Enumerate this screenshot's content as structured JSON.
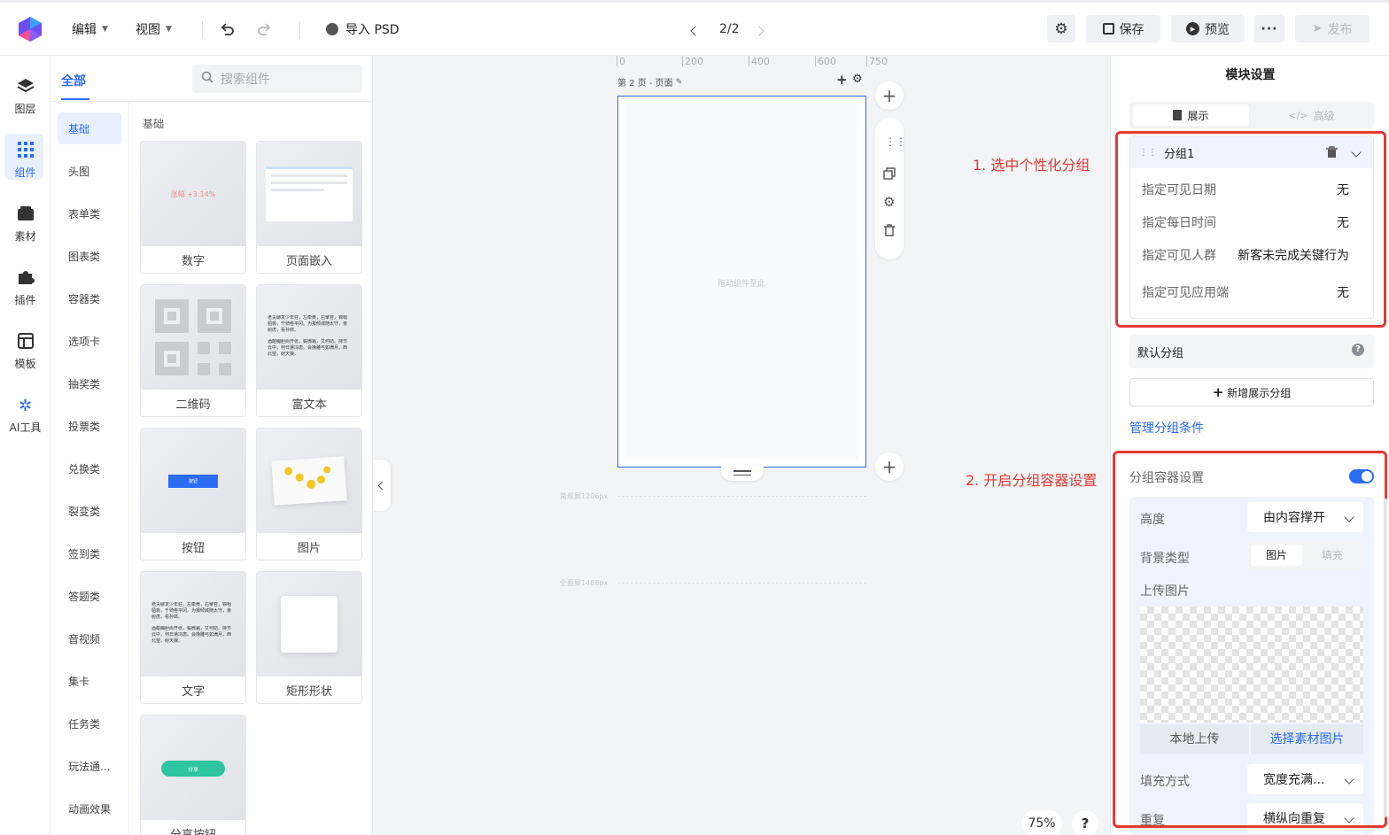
{
  "toolbar": {
    "edit_menu": "编辑",
    "view_menu": "视图",
    "import_psd": "导入 PSD",
    "page_indicator": "2/2",
    "save": "保存",
    "preview": "预览",
    "publish": "发布"
  },
  "rail": [
    "图层",
    "组件",
    "素材",
    "插件",
    "模板",
    "AI工具"
  ],
  "components": {
    "tab_all": "全部",
    "search_placeholder": "搜索组件",
    "section_title": "基础",
    "categories": [
      "基础",
      "头图",
      "表单类",
      "图表类",
      "容器类",
      "选项卡",
      "抽奖类",
      "投票类",
      "兑换类",
      "裂变类",
      "签到类",
      "答题类",
      "音视频",
      "集卡",
      "任务类",
      "玩法通...",
      "动画效果"
    ],
    "cards": [
      "数字",
      "页面嵌入",
      "二维码",
      "富文本",
      "按钮",
      "图片",
      "文字",
      "矩形形状",
      "分享按钮"
    ],
    "thumb_number_text": "涨幅 +3.14%",
    "thumb_richtext_a": "老夫聊发少年狂，左牵黄，右擎苍，锦帽貂裘，千骑卷平冈。为报倾城随太守，亲射虎，看孙郎。",
    "thumb_richtext_b": "酒酣胸胆尚开张，鬓微霜，又何妨。持节云中，何日遣冯唐。会挽雕弓如满月，西北望，射天狼。",
    "thumb_button_text": "按钮",
    "thumb_share_text": "分享"
  },
  "canvas": {
    "ruler": [
      "0",
      "200",
      "400",
      "600",
      "750"
    ],
    "page_label": "第 2 页 - 页面",
    "drop_hint": "拖动组件至此",
    "guide_1": "常规屏1206px",
    "guide_2": "全面屏1468px",
    "zoom": "75%",
    "help": "?"
  },
  "annotations": {
    "step1": "1. 选中个性化分组",
    "step2": "2. 开启分组容器设置"
  },
  "settings": {
    "title": "模块设置",
    "tab_display": "展示",
    "tab_advanced": "高级",
    "group_name": "分组1",
    "rows": [
      {
        "label": "指定可见日期",
        "value": "无"
      },
      {
        "label": "指定每日时间",
        "value": "无"
      },
      {
        "label": "指定可见人群",
        "value": "新客未完成关键行为"
      },
      {
        "label": "指定可见应用端",
        "value": "无"
      }
    ],
    "default_group": "默认分组",
    "add_group": "新增展示分组",
    "manage_link": "管理分组条件",
    "container_setting": "分组容器设置",
    "container_enabled": true,
    "height_label": "高度",
    "height_value": "由内容撑开",
    "bg_type_label": "背景类型",
    "bg_type_image": "图片",
    "bg_type_fill": "填充",
    "upload_label": "上传图片",
    "local_upload": "本地上传",
    "choose_material": "选择素材图片",
    "fill_mode_label": "填充方式",
    "fill_mode_value": "宽度充满...",
    "repeat_label": "重复",
    "repeat_value": "横纵向重复"
  },
  "colors": {
    "accent": "#2b6cf2",
    "annotation": "#e53935",
    "share_button": "#2ec4a0"
  }
}
